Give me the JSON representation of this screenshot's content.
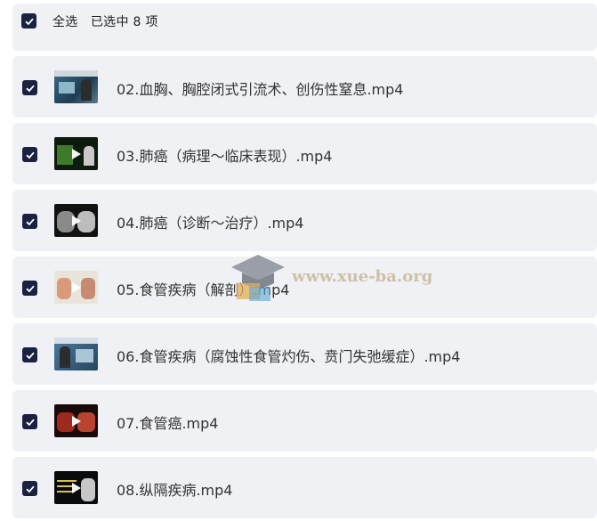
{
  "header": {
    "select_all_label": "全选",
    "selected_text": "已选中 8 项"
  },
  "files": [
    {
      "name": "02.血胸、胸腔闭式引流术、创伤性窒息.mp4",
      "checked": true,
      "play": false
    },
    {
      "name": "03.肺癌（病理～临床表现）.mp4",
      "checked": true,
      "play": true
    },
    {
      "name": "04.肺癌（诊断～治疗）.mp4",
      "checked": true,
      "play": true
    },
    {
      "name": "05.食管疾病（解剖）.mp4",
      "checked": true,
      "play": true
    },
    {
      "name": "06.食管疾病（腐蚀性食管灼伤、贲门失弛缓症）.mp4",
      "checked": true,
      "play": false
    },
    {
      "name": "07.食管癌.mp4",
      "checked": true,
      "play": true
    },
    {
      "name": "08.纵隔疾病.mp4",
      "checked": true,
      "play": true
    }
  ],
  "watermark": {
    "text": "www.xue-ba.org",
    "icon": "graduation-cap-icon"
  },
  "colors": {
    "checkbox": "#1b2140",
    "row_background": "#f0f1f4"
  }
}
